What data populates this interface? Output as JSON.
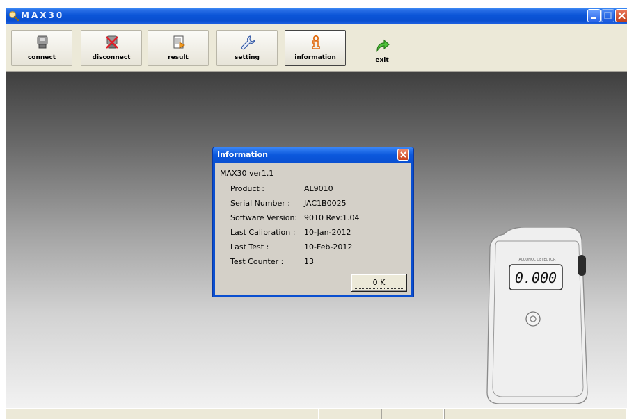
{
  "window": {
    "title": "MAX30"
  },
  "toolbar": {
    "buttons": [
      {
        "id": "connect",
        "label": "connect",
        "icon": "connect-icon"
      },
      {
        "id": "disconnect",
        "label": "disconnect",
        "icon": "disconnect-icon"
      },
      {
        "id": "result",
        "label": "result",
        "icon": "result-icon"
      },
      {
        "id": "setting",
        "label": "setting",
        "icon": "wrench-icon"
      },
      {
        "id": "information",
        "label": "information",
        "icon": "information-icon"
      },
      {
        "id": "exit",
        "label": "exit",
        "icon": "exit-arrow-icon"
      }
    ]
  },
  "dialog": {
    "title": "Information",
    "version": "MAX30 ver1.1",
    "rows": [
      {
        "label": "Product :",
        "value": "AL9010"
      },
      {
        "label": "Serial Number :",
        "value": "JAC1B0025"
      },
      {
        "label": "Software Version:",
        "value": "9010 Rev:1.04"
      },
      {
        "label": "Last Calibration :",
        "value": "10-Jan-2012"
      },
      {
        "label": "Last Test :",
        "value": "10-Feb-2012"
      },
      {
        "label": "Test Counter :",
        "value": "13"
      }
    ],
    "ok_label": "0 K"
  },
  "device": {
    "brand": "ALCOHOL DETECTOR",
    "display_value": "0.000"
  },
  "colors": {
    "titlebar": "#0b55d8",
    "toolbar_bg": "#ece9d8",
    "dialog_bg": "#d4d0c8",
    "close_red": "#c3401c"
  }
}
